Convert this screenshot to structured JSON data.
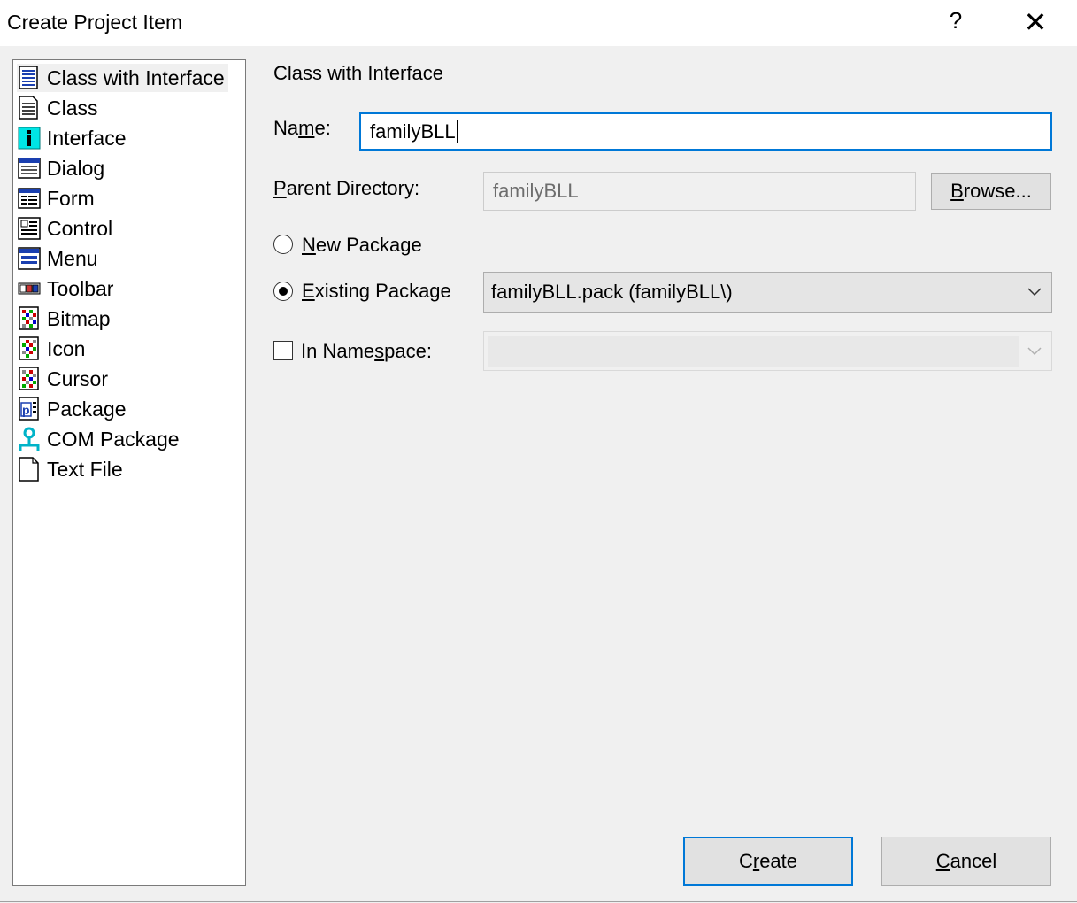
{
  "window": {
    "title": "Create Project Item",
    "help_glyph": "?",
    "close_glyph": "✕"
  },
  "item_list": {
    "items": [
      {
        "label": "Class with Interface",
        "icon": "class-with-interface-icon",
        "selected": true
      },
      {
        "label": "Class",
        "icon": "class-icon"
      },
      {
        "label": "Interface",
        "icon": "interface-icon"
      },
      {
        "label": "Dialog",
        "icon": "dialog-icon"
      },
      {
        "label": "Form",
        "icon": "form-icon"
      },
      {
        "label": "Control",
        "icon": "control-icon"
      },
      {
        "label": "Menu",
        "icon": "menu-icon"
      },
      {
        "label": "Toolbar",
        "icon": "toolbar-icon"
      },
      {
        "label": "Bitmap",
        "icon": "bitmap-icon"
      },
      {
        "label": "Icon",
        "icon": "icon-resource-icon"
      },
      {
        "label": "Cursor",
        "icon": "cursor-icon"
      },
      {
        "label": "Package",
        "icon": "package-icon"
      },
      {
        "label": "COM Package",
        "icon": "com-package-icon"
      },
      {
        "label": "Text File",
        "icon": "text-file-icon"
      }
    ]
  },
  "form": {
    "heading": "Class with Interface",
    "name_label_pre": "Na",
    "name_label_u": "m",
    "name_label_post": "e:",
    "name_value": "familyBLL",
    "parent_label_u": "P",
    "parent_label_post": "arent Directory:",
    "parent_value": "familyBLL",
    "browse_u": "B",
    "browse_post": "rowse...",
    "new_package_u": "N",
    "new_package_post": "ew Package",
    "existing_package_u": "E",
    "existing_package_post": "xisting Package",
    "existing_package_value": "familyBLL.pack (familyBLL\\)",
    "namespace_pre": "In Name",
    "namespace_u": "s",
    "namespace_post": "pace:",
    "namespace_value": ""
  },
  "buttons": {
    "create_pre": "C",
    "create_u": "r",
    "create_post": "eate",
    "cancel_u": "C",
    "cancel_post": "ancel"
  },
  "colors": {
    "accent": "#0078d7",
    "dialog_bg": "#f0f0f0"
  }
}
